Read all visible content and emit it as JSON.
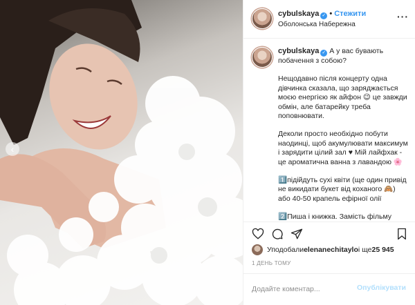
{
  "post": {
    "username": "cybulskaya",
    "follow_label": "Стежити",
    "location": "Оболонська Набережна",
    "more_icon": "more-options-icon"
  },
  "caption": {
    "username": "cybulskaya",
    "p1": "А у вас бувають побачення з собою?",
    "p2": "Нещодавно після концерту одна дівчинка сказала, що заряджається моєю енергією як айфон 😉 це завжди обмін, але батарейку треба поповнювати.",
    "p3": "Деколи просто необхідно побути наодинці, щоб акумулювати максимум і зарядити цілий зал ♥ Мій лайфхак - це ароматична ванна з лавандою 🌸",
    "p4": "1️⃣підійдуть сухі квіти (ще один привід не викидати букет від коханого 🙈) або 40-50 крапель ефірної олії",
    "p5": "2️⃣Пиша і книжка. Замість фільму"
  },
  "engagement": {
    "liked_by_prefix": "Уподобали ",
    "liked_by_user": "elenanechitaylo",
    "liked_by_suffix": " і ще ",
    "likes_count": "25 945",
    "timestamp": "1 ДЕНЬ ТОМУ"
  },
  "comment": {
    "placeholder": "Додайте коментар...",
    "post_label": "Опублікувати"
  },
  "colors": {
    "accent": "#3897f0",
    "post_disabled": "#b2dffc",
    "muted": "#8e8e8e"
  }
}
